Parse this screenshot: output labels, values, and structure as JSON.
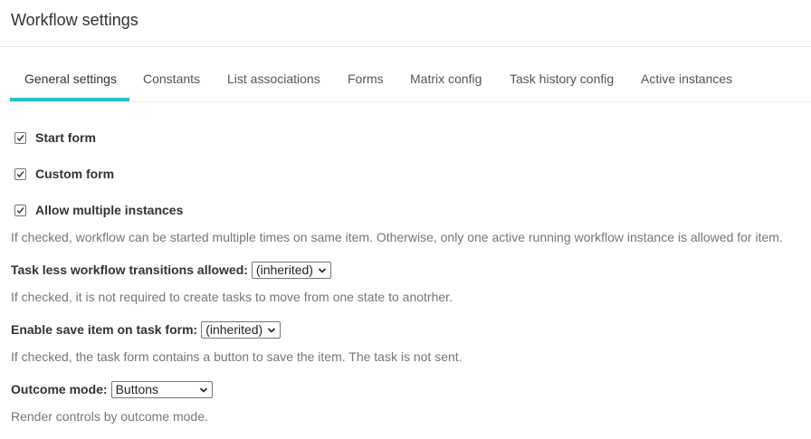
{
  "header": {
    "title": "Workflow settings"
  },
  "tabs": [
    {
      "label": "General settings",
      "active": true
    },
    {
      "label": "Constants",
      "active": false
    },
    {
      "label": "List associations",
      "active": false
    },
    {
      "label": "Forms",
      "active": false
    },
    {
      "label": "Matrix config",
      "active": false
    },
    {
      "label": "Task history config",
      "active": false
    },
    {
      "label": "Active instances",
      "active": false
    }
  ],
  "accent_color": "#2bbfc4",
  "settings": {
    "start_form": {
      "label": "Start form",
      "checked": true
    },
    "custom_form": {
      "label": "Custom form",
      "checked": true
    },
    "allow_multiple": {
      "label": "Allow multiple instances",
      "checked": true,
      "help": "If checked, workflow can be started multiple times on same item. Otherwise, only one active running workflow instance is allowed for item."
    },
    "task_less": {
      "label": "Task less workflow transitions allowed:",
      "value": "(inherited)",
      "help": "If checked, it is not required to create tasks to move from one state to anotrher."
    },
    "save_item": {
      "label": "Enable save item on task form:",
      "value": "(inherited)",
      "help": "If checked, the task form contains a button to save the item. The task is not sent."
    },
    "outcome_mode": {
      "label": "Outcome mode:",
      "value": "Buttons",
      "help": "Render controls by outcome mode."
    }
  }
}
